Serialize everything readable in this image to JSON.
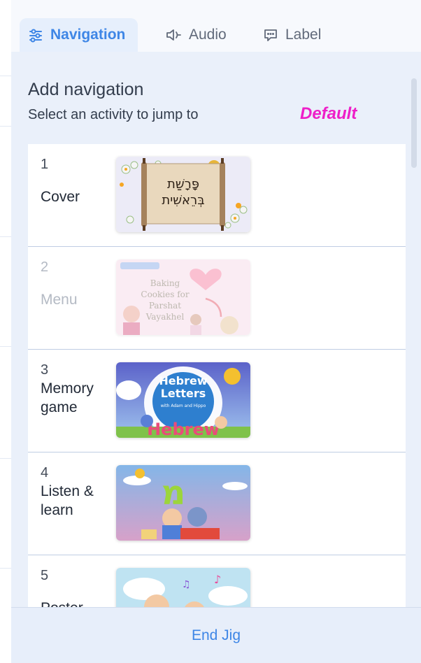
{
  "tabs": [
    {
      "label": "Navigation",
      "icon": "sliders-icon",
      "active": true
    },
    {
      "label": "Audio",
      "icon": "speaker-icon",
      "active": false
    },
    {
      "label": "Label",
      "icon": "comment-icon",
      "active": false
    }
  ],
  "panel": {
    "heading": "Add navigation",
    "subheading": "Select an activity to jump to",
    "default_tag": "Default"
  },
  "activities": [
    {
      "number": "1",
      "name": "Cover",
      "thumbnail": "parashat-bereshit-scroll",
      "thumb_text": [
        "פָּרָשַׁת",
        "בְּרֵאשִׁית"
      ],
      "disabled": false
    },
    {
      "number": "2",
      "name": "Menu",
      "thumbnail": "baking-cookies",
      "thumb_text": [
        "Baking",
        "Cookies for",
        "Parshat",
        "Vayakhel"
      ],
      "disabled": true
    },
    {
      "number": "3",
      "name": "Memory game",
      "thumbnail": "hebrew-letters",
      "thumb_text": [
        "Hebrew",
        "Letters",
        "with Adam and Hippo",
        "Hebrew"
      ],
      "disabled": false
    },
    {
      "number": "4",
      "name": "Listen & learn",
      "thumbnail": "hebrew-letter-mem",
      "thumb_text": [
        "מ"
      ],
      "disabled": false
    },
    {
      "number": "5",
      "name": "Poster",
      "thumbnail": "music-poster",
      "thumb_text": [],
      "disabled": false
    }
  ],
  "footer": {
    "label": "End Jig"
  },
  "colors": {
    "accent": "#3e86e6",
    "default_tag": "#ee1fc8",
    "panel_bg": "#eaf0fa"
  }
}
